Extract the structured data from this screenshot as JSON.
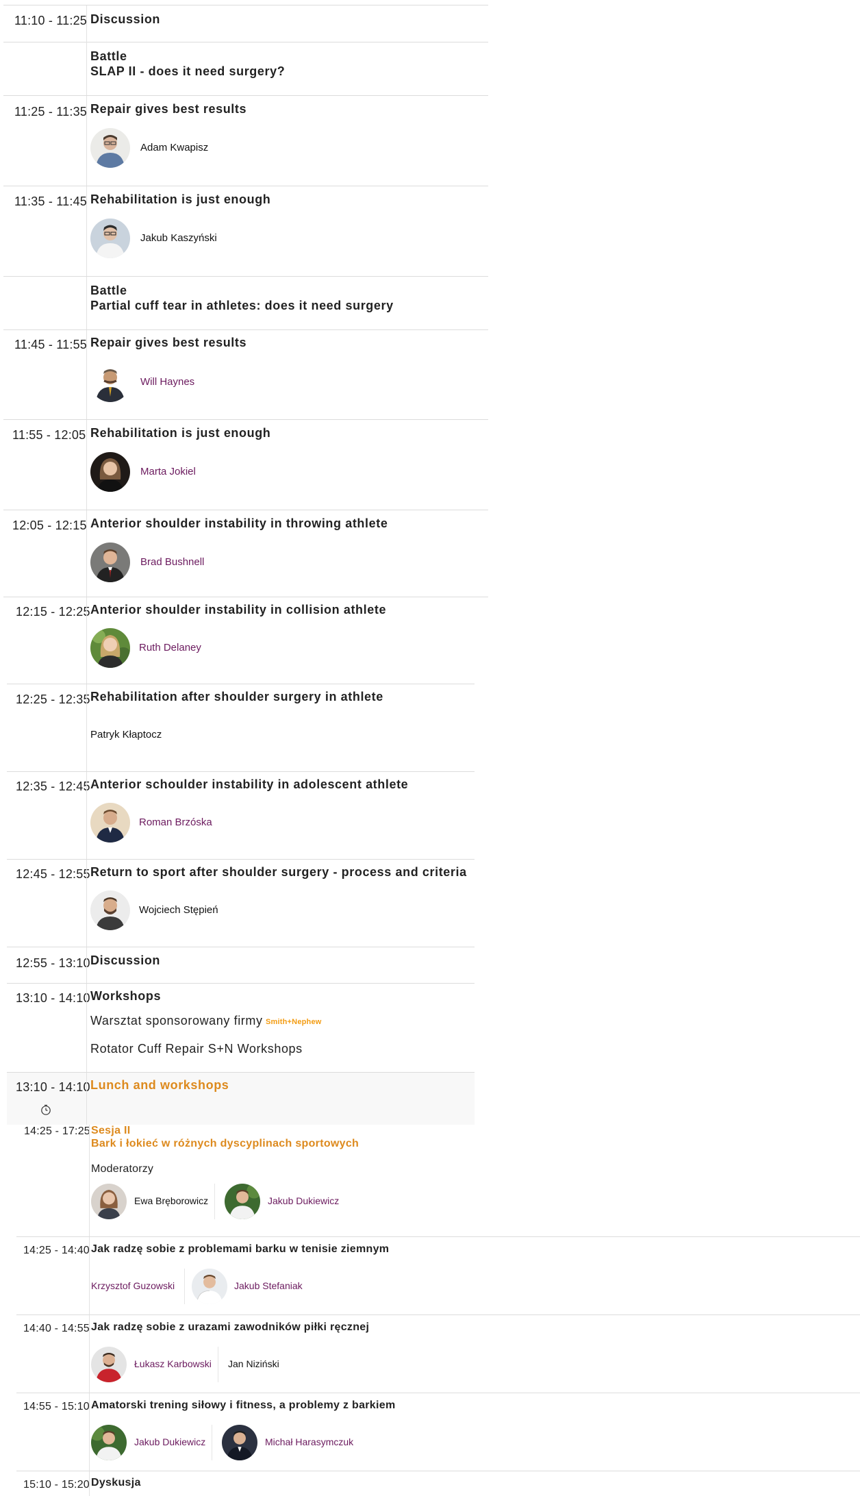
{
  "agenda": [
    {
      "time": "11:10 - 11:25",
      "title": "Discussion"
    },
    {
      "time": "",
      "title": "Battle",
      "subtitle": "SLAP II - does it need surgery?"
    },
    {
      "time": "11:25 - 11:35",
      "title": "Repair gives best results",
      "speaker": "Adam Kwapisz"
    },
    {
      "time": "11:35 - 11:45",
      "title": "Rehabilitation is just enough",
      "speaker": "Jakub Kaszyński"
    },
    {
      "time": "",
      "title": "Battle",
      "subtitle": "Partial cuff tear in athletes: does it need surgery"
    },
    {
      "time": "11:45 - 11:55",
      "title": "Repair gives best results",
      "speaker": "Will Haynes"
    },
    {
      "time": "11:55 - 12:05",
      "title": "Rehabilitation is just enough",
      "speaker": "Marta Jokiel"
    },
    {
      "time": "12:05 - 12:15",
      "title": "Anterior shoulder instability in throwing athlete",
      "speaker": "Brad Bushnell"
    },
    {
      "time": "12:15 - 12:25",
      "title": "Anterior shoulder instability in collision athlete",
      "speaker": "Ruth Delaney"
    },
    {
      "time": "12:25 - 12:35",
      "title": "Rehabilitation after shoulder surgery in athlete",
      "speaker": "Patryk Kłaptocz"
    },
    {
      "time": "12:35 - 12:45",
      "title": "Anterior schoulder instability in adolescent athlete",
      "speaker": "Roman Brzóska"
    },
    {
      "time": "12:45 - 12:55",
      "title": "Return to sport after shoulder surgery - process and criteria",
      "speaker": "Wojciech Stępień"
    },
    {
      "time": "12:55 - 13:10",
      "title": "Discussion"
    },
    {
      "time": "13:10 - 14:10",
      "title": "Workshops",
      "line1": "Warsztat sponsorowany firmy",
      "logo": "Smith+Nephew",
      "line2": "Rotator Cuff Repair S+N Workshops"
    },
    {
      "time": "13:10 - 14:10",
      "title": "Lunch and workshops"
    }
  ],
  "session2": {
    "time": "14:25 - 17:25",
    "label": "Sesja II",
    "title": "Bark i łokieć w różnych dyscyplinach sportowych",
    "moderators_label": "Moderatorzy",
    "moderators": [
      "Ewa Bręborowicz",
      "Jakub Dukiewicz"
    ],
    "talks": [
      {
        "time": "14:25 - 14:40",
        "title": "Jak radzę sobie z problemami barku w tenisie ziemnym",
        "speakers": [
          "Krzysztof Guzowski",
          "Jakub Stefaniak"
        ]
      },
      {
        "time": "14:40 - 14:55",
        "title": "Jak radzę sobie z urazami zawodników piłki ręcznej",
        "speakers": [
          "Łukasz Karbowski",
          "Jan Niziński"
        ]
      },
      {
        "time": "14:55 - 15:10",
        "title": "Amatorski trening siłowy i fitness, a problemy z barkiem",
        "speakers": [
          "Jakub Dukiewicz",
          "Michał Harasymczuk"
        ]
      },
      {
        "time": "15:10 - 15:20",
        "title": "Dyskusja"
      }
    ]
  },
  "colors": {
    "link": "#6b1a5e",
    "accent": "#dd8a1e",
    "logo": "#f39c12"
  }
}
